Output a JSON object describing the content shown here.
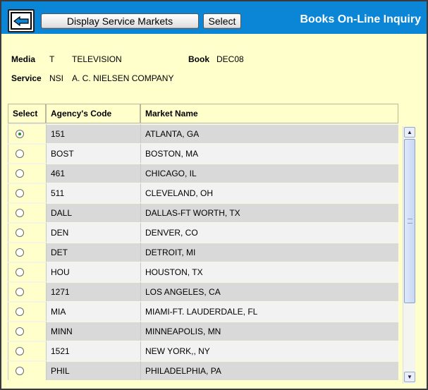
{
  "toolbar": {
    "back_icon": "back-arrow-icon",
    "display_label": "Display Service Markets",
    "select_label": "Select",
    "title": "Books On-Line Inquiry"
  },
  "info": {
    "media_label": "Media",
    "media_code": "T",
    "media_name": "TELEVISION",
    "book_label": "Book",
    "book_value": "DEC08",
    "service_label": "Service",
    "service_code": "NSI",
    "service_name": "A. C. NIELSEN COMPANY"
  },
  "table": {
    "headers": [
      "Select",
      "Agency's Code",
      "Market Name"
    ],
    "selected_index": 0,
    "rows": [
      {
        "code": "151",
        "market": "ATLANTA, GA"
      },
      {
        "code": "BOST",
        "market": "BOSTON, MA"
      },
      {
        "code": "461",
        "market": "CHICAGO, IL"
      },
      {
        "code": "511",
        "market": "CLEVELAND, OH"
      },
      {
        "code": "DALL",
        "market": "DALLAS-FT WORTH, TX"
      },
      {
        "code": "DEN",
        "market": "DENVER, CO"
      },
      {
        "code": "DET",
        "market": "DETROIT, MI"
      },
      {
        "code": "HOU",
        "market": "HOUSTON, TX"
      },
      {
        "code": "1271",
        "market": "LOS ANGELES, CA"
      },
      {
        "code": "MIA",
        "market": "MIAMI-FT. LAUDERDALE, FL"
      },
      {
        "code": "MINN",
        "market": "MINNEAPOLIS, MN"
      },
      {
        "code": "1521",
        "market": "NEW YORK,, NY"
      },
      {
        "code": "PHIL",
        "market": "PHILADELPHIA, PA"
      }
    ]
  },
  "colors": {
    "toolbar_bg": "#0b86d6",
    "page_bg": "#ffffcc",
    "row_dark": "#d9d9d9",
    "row_light": "#f2f2f2"
  }
}
